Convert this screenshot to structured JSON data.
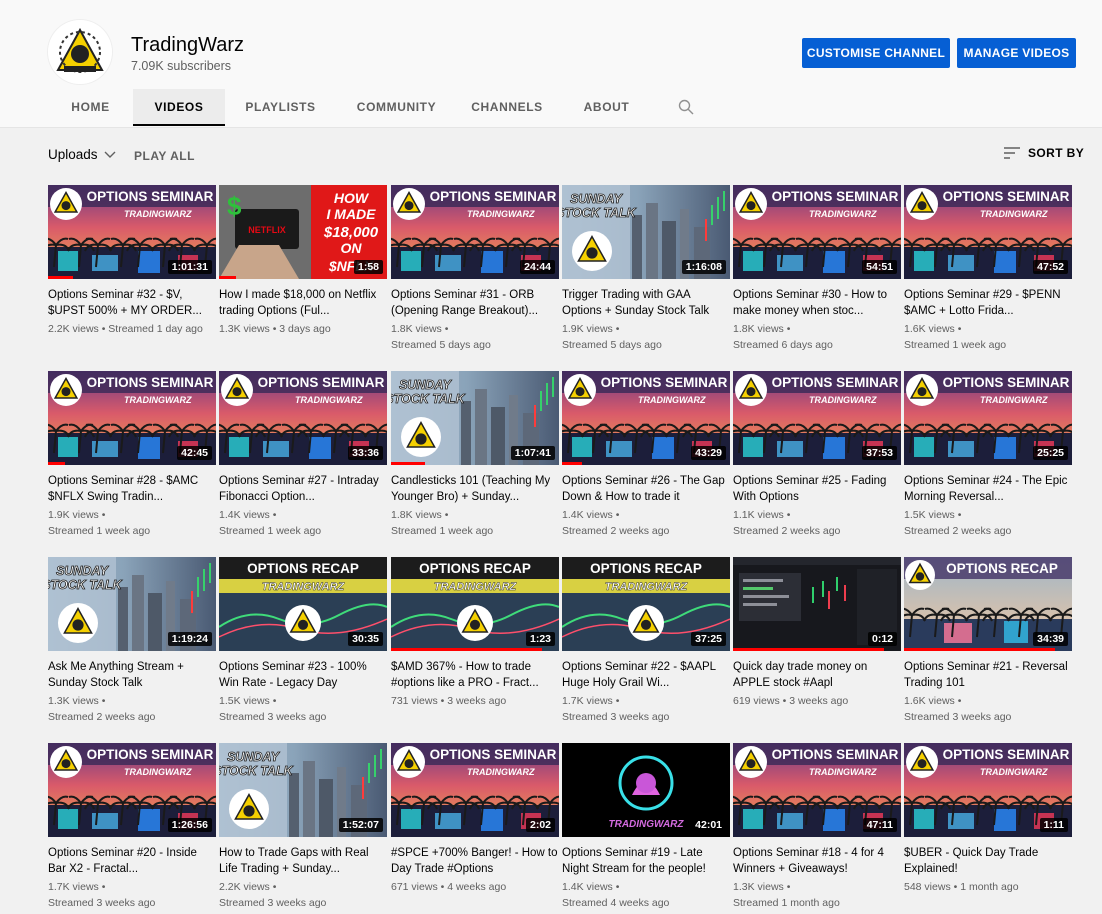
{
  "channel": {
    "name": "TradingWarz",
    "subscribers": "7.09K subscribers"
  },
  "buttons": {
    "customise": "CUSTOMISE CHANNEL",
    "manage": "MANAGE VIDEOS"
  },
  "tabs": [
    {
      "label": "HOME",
      "active": false
    },
    {
      "label": "VIDEOS",
      "active": true
    },
    {
      "label": "PLAYLISTS",
      "active": false
    },
    {
      "label": "COMMUNITY",
      "active": false
    },
    {
      "label": "CHANNELS",
      "active": false
    },
    {
      "label": "ABOUT",
      "active": false
    }
  ],
  "toolbar": {
    "uploads": "Uploads",
    "play_all": "PLAY ALL",
    "sort_by": "SORT BY"
  },
  "colors": {
    "accent": "#065fd4",
    "progress": "#ff0000"
  },
  "thumb_text": {
    "seminar": "OPTIONS SEMINAR",
    "recap": "OPTIONS RECAP",
    "brand": "TRADINGWARZ",
    "sunday": "SUNDAY",
    "stock_talk": "STOCK TALK",
    "netflix_headline": [
      "HOW",
      "I MADE",
      "$18,000",
      "ON",
      "$NFLX"
    ]
  },
  "videos": [
    {
      "title": "Options Seminar #32 - $V, $UPST 500% + MY ORDER...",
      "meta1": "2.2K views • Streamed 1 day ago",
      "meta2": "",
      "duration": "1:01:31",
      "type": "seminar",
      "progress": 0.15
    },
    {
      "title": "How I made $18,000 on Netflix trading Options (Ful...",
      "meta1": "1.3K views • 3 days ago",
      "meta2": "",
      "duration": "1:58",
      "type": "netflix",
      "progress": 0.1
    },
    {
      "title": "Options Seminar #31 - ORB (Opening Range Breakout)...",
      "meta1": "1.8K views •",
      "meta2": "Streamed 5 days ago",
      "duration": "24:44",
      "type": "seminar",
      "progress": 0
    },
    {
      "title": "Trigger Trading with GAA Options + Sunday Stock Talk",
      "meta1": "1.9K views •",
      "meta2": "Streamed 5 days ago",
      "duration": "1:16:08",
      "type": "sunday",
      "progress": 0
    },
    {
      "title": "Options Seminar #30 - How to make money when stoc...",
      "meta1": "1.8K views •",
      "meta2": "Streamed 6 days ago",
      "duration": "54:51",
      "type": "seminar",
      "progress": 0
    },
    {
      "title": "Options Seminar #29 - $PENN $AMC + Lotto Frida...",
      "meta1": "1.6K views •",
      "meta2": "Streamed 1 week ago",
      "duration": "47:52",
      "type": "seminar",
      "progress": 0
    },
    {
      "title": "Options Seminar #28 - $AMC $NFLX Swing Tradin...",
      "meta1": "1.9K views •",
      "meta2": "Streamed 1 week ago",
      "duration": "42:45",
      "type": "seminar",
      "progress": 0.1
    },
    {
      "title": "Options Seminar #27 - Intraday Fibonacci Option...",
      "meta1": "1.4K views •",
      "meta2": "Streamed 1 week ago",
      "duration": "33:36",
      "type": "seminar",
      "progress": 0
    },
    {
      "title": "Candlesticks 101 (Teaching My Younger Bro) + Sunday...",
      "meta1": "1.8K views •",
      "meta2": "Streamed 1 week ago",
      "duration": "1:07:41",
      "type": "sunday",
      "progress": 0.2
    },
    {
      "title": "Options Seminar #26 - The Gap Down & How to trade it",
      "meta1": "1.4K views •",
      "meta2": "Streamed 2 weeks ago",
      "duration": "43:29",
      "type": "seminar",
      "progress": 0.12
    },
    {
      "title": "Options Seminar #25 - Fading With Options",
      "meta1": "1.1K views •",
      "meta2": "Streamed 2 weeks ago",
      "duration": "37:53",
      "type": "seminar",
      "progress": 0
    },
    {
      "title": "Options Seminar #24 - The Epic Morning Reversal...",
      "meta1": "1.5K views •",
      "meta2": "Streamed 2 weeks ago",
      "duration": "25:25",
      "type": "seminar",
      "progress": 0
    },
    {
      "title": "Ask Me Anything Stream + Sunday Stock Talk",
      "meta1": "1.3K views •",
      "meta2": "Streamed 2 weeks ago",
      "duration": "1:19:24",
      "type": "sunday",
      "progress": 0
    },
    {
      "title": "Options Seminar #23 - 100% Win Rate - Legacy Day",
      "meta1": "1.5K views •",
      "meta2": "Streamed 3 weeks ago",
      "duration": "30:35",
      "type": "recap",
      "progress": 0
    },
    {
      "title": "$AMD 367% - How to trade #options like a PRO - Fract...",
      "meta1": "731 views • 3 weeks ago",
      "meta2": "",
      "duration": "1:23",
      "type": "recap",
      "progress": 0.9
    },
    {
      "title": "Options Seminar #22 - $AAPL Huge Holy Grail Wi...",
      "meta1": "1.7K views •",
      "meta2": "Streamed 3 weeks ago",
      "duration": "37:25",
      "type": "recap",
      "progress": 0
    },
    {
      "title": "Quick day trade money on APPLE stock #Aapl",
      "meta1": "619 views • 3 weeks ago",
      "meta2": "",
      "duration": "0:12",
      "type": "screen",
      "progress": 0.9
    },
    {
      "title": "Options Seminar #21 - Reversal Trading 101",
      "meta1": "1.6K views •",
      "meta2": "Streamed 3 weeks ago",
      "duration": "34:39",
      "type": "recap2",
      "progress": 0.9
    },
    {
      "title": "Options Seminar #20 - Inside Bar X2 - Fractal...",
      "meta1": "1.7K views •",
      "meta2": "Streamed 3 weeks ago",
      "duration": "1:26:56",
      "type": "seminar",
      "progress": 0
    },
    {
      "title": "How to Trade Gaps with Real Life Trading + Sunday...",
      "meta1": "2.2K views •",
      "meta2": "Streamed 3 weeks ago",
      "duration": "1:52:07",
      "type": "sunday",
      "progress": 0
    },
    {
      "title": "#SPCE +700% Banger! - How to Day Trade #Options",
      "meta1": "671 views • 4 weeks ago",
      "meta2": "",
      "duration": "2:02",
      "type": "seminar",
      "progress": 0
    },
    {
      "title": "Options Seminar #19 - Late Night Stream for the people!",
      "meta1": "1.4K views •",
      "meta2": "Streamed 4 weeks ago",
      "duration": "42:01",
      "type": "logo",
      "progress": 0
    },
    {
      "title": "Options Seminar #18 - 4 for 4 Winners + Giveaways!",
      "meta1": "1.3K views •",
      "meta2": "Streamed 1 month ago",
      "duration": "47:11",
      "type": "seminar",
      "progress": 0
    },
    {
      "title": "$UBER - Quick Day Trade Explained!",
      "meta1": "548 views • 1 month ago",
      "meta2": "",
      "duration": "1:11",
      "type": "seminar",
      "progress": 0
    }
  ]
}
